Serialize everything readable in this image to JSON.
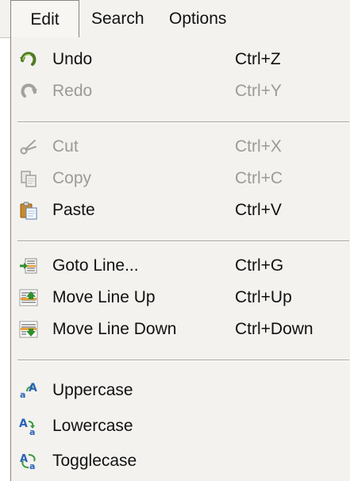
{
  "menubar": {
    "items": [
      {
        "label": "Edit"
      },
      {
        "label": "Search"
      },
      {
        "label": "Options"
      }
    ]
  },
  "edit_menu": {
    "undo": {
      "label": "Undo",
      "shortcut": "Ctrl+Z",
      "icon": "undo-icon",
      "enabled": true
    },
    "redo": {
      "label": "Redo",
      "shortcut": "Ctrl+Y",
      "icon": "redo-icon",
      "enabled": false
    },
    "cut": {
      "label": "Cut",
      "shortcut": "Ctrl+X",
      "icon": "scissors-icon",
      "enabled": false
    },
    "copy": {
      "label": "Copy",
      "shortcut": "Ctrl+C",
      "icon": "copy-icon",
      "enabled": false
    },
    "paste": {
      "label": "Paste",
      "shortcut": "Ctrl+V",
      "icon": "paste-icon",
      "enabled": true
    },
    "goto_line": {
      "label": "Goto Line...",
      "shortcut": "Ctrl+G",
      "icon": "goto-line-icon",
      "enabled": true
    },
    "move_up": {
      "label": "Move Line Up",
      "shortcut": "Ctrl+Up",
      "icon": "move-line-up-icon",
      "enabled": true
    },
    "move_down": {
      "label": "Move Line Down",
      "shortcut": "Ctrl+Down",
      "icon": "move-line-down-icon",
      "enabled": true
    },
    "uppercase": {
      "label": "Uppercase",
      "icon": "uppercase-icon",
      "enabled": true
    },
    "lowercase": {
      "label": "Lowercase",
      "icon": "lowercase-icon",
      "enabled": true
    },
    "togglecase": {
      "label": "Togglecase",
      "icon": "togglecase-icon",
      "enabled": true
    }
  },
  "colors": {
    "menu_background": "#f3f2ef",
    "text": "#111111",
    "disabled_text": "#9c9a94",
    "separator": "#a8a59c"
  }
}
